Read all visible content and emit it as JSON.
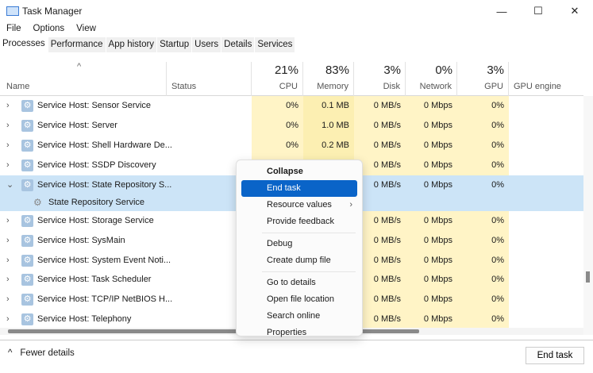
{
  "window": {
    "title": "Task Manager",
    "minimize": "—",
    "maximize": "☐",
    "close": "✕"
  },
  "menu": [
    "File",
    "Options",
    "View"
  ],
  "tabs": [
    "Processes",
    "Performance",
    "App history",
    "Startup",
    "Users",
    "Details",
    "Services"
  ],
  "columns": {
    "name": "Name",
    "status": "Status",
    "cpu": {
      "pct": "21%",
      "label": "CPU"
    },
    "memory": {
      "pct": "83%",
      "label": "Memory"
    },
    "disk": {
      "pct": "3%",
      "label": "Disk"
    },
    "network": {
      "pct": "0%",
      "label": "Network"
    },
    "gpu": {
      "pct": "3%",
      "label": "GPU"
    },
    "gpu_engine": "GPU engine"
  },
  "rows": [
    {
      "name": "Service Host: Sensor Service",
      "cpu": "0%",
      "mem": "0.1 MB",
      "disk": "0 MB/s",
      "net": "0 Mbps",
      "gpu": "0%"
    },
    {
      "name": "Service Host: Server",
      "cpu": "0%",
      "mem": "1.0 MB",
      "disk": "0 MB/s",
      "net": "0 Mbps",
      "gpu": "0%"
    },
    {
      "name": "Service Host: Shell Hardware De...",
      "cpu": "0%",
      "mem": "0.2 MB",
      "disk": "0 MB/s",
      "net": "0 Mbps",
      "gpu": "0%"
    },
    {
      "name": "Service Host: SSDP Discovery",
      "disk": "0 MB/s",
      "net": "0 Mbps",
      "gpu": "0%"
    },
    {
      "name": "Service Host: State Repository S...",
      "disk": "0 MB/s",
      "net": "0 Mbps",
      "gpu": "0%",
      "expanded": true,
      "selected": true
    },
    {
      "name": "State Repository Service",
      "child": true,
      "selected": true
    },
    {
      "name": "Service Host: Storage Service",
      "disk": "0 MB/s",
      "net": "0 Mbps",
      "gpu": "0%"
    },
    {
      "name": "Service Host: SysMain",
      "disk": "0 MB/s",
      "net": "0 Mbps",
      "gpu": "0%"
    },
    {
      "name": "Service Host: System Event Noti...",
      "disk": "0 MB/s",
      "net": "0 Mbps",
      "gpu": "0%"
    },
    {
      "name": "Service Host: Task Scheduler",
      "disk": "0 MB/s",
      "net": "0 Mbps",
      "gpu": "0%"
    },
    {
      "name": "Service Host: TCP/IP NetBIOS H...",
      "disk": "0 MB/s",
      "net": "0 Mbps",
      "gpu": "0%"
    },
    {
      "name": "Service Host: Telephony",
      "disk": "0 MB/s",
      "net": "0 Mbps",
      "gpu": "0%"
    }
  ],
  "context_menu": [
    {
      "label": "Collapse",
      "bold": true
    },
    {
      "label": "End task",
      "highlighted": true
    },
    {
      "label": "Resource values",
      "submenu": true
    },
    {
      "label": "Provide feedback"
    },
    {
      "sep": true
    },
    {
      "label": "Debug"
    },
    {
      "label": "Create dump file"
    },
    {
      "sep": true
    },
    {
      "label": "Go to details"
    },
    {
      "label": "Open file location"
    },
    {
      "label": "Search online"
    },
    {
      "label": "Properties"
    }
  ],
  "footer": {
    "fewer_details": "Fewer details",
    "end_task": "End task"
  },
  "colors": {
    "accent": "#0a64c8",
    "selection": "#cce4f7",
    "heat_light": "#fff4c6",
    "heat_mem": "#fcefb2"
  }
}
